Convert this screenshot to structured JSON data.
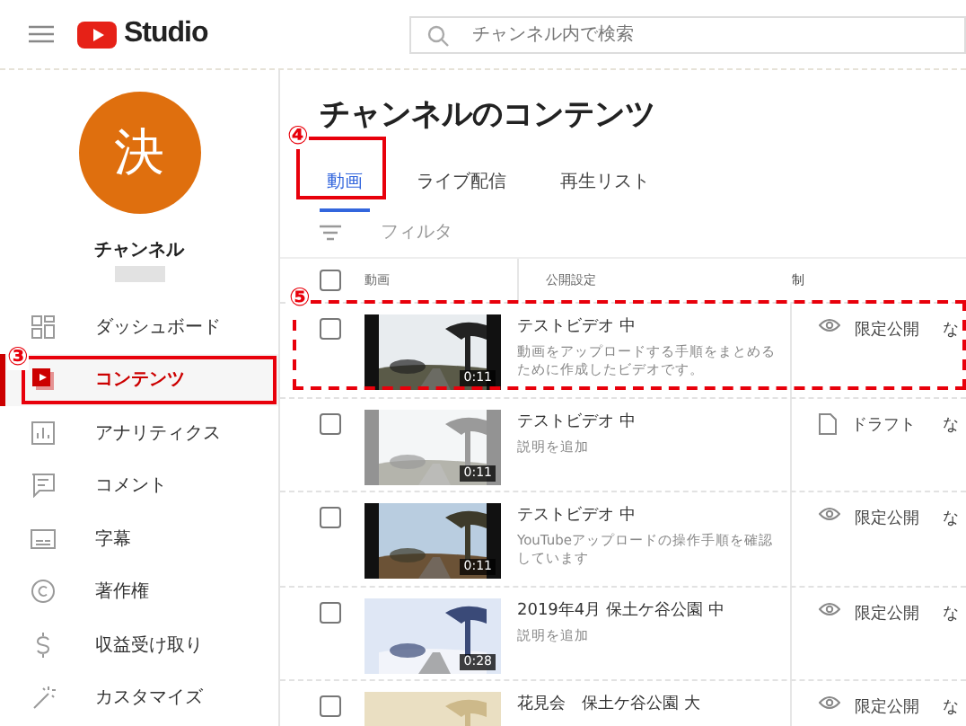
{
  "header": {
    "logo_text": "Studio",
    "search": {
      "placeholder": "チャンネル内で検索"
    }
  },
  "channel": {
    "avatar_letter": "決",
    "name": "チャンネル"
  },
  "sidebar": {
    "items": [
      {
        "label": "ダッシュボード",
        "selected": false
      },
      {
        "label": "コンテンツ",
        "selected": true,
        "annotation": "③"
      },
      {
        "label": "アナリティクス",
        "selected": false
      },
      {
        "label": "コメント",
        "selected": false
      },
      {
        "label": "字幕",
        "selected": false
      },
      {
        "label": "著作権",
        "selected": false
      },
      {
        "label": "収益受け取り",
        "selected": false
      },
      {
        "label": "カスタマイズ",
        "selected": false
      }
    ]
  },
  "page_title": "チャンネルのコンテンツ",
  "tabs": [
    {
      "label": "動画",
      "selected": true,
      "annotation": "④"
    },
    {
      "label": "ライブ配信",
      "selected": false
    },
    {
      "label": "再生リスト",
      "selected": false
    }
  ],
  "filter": {
    "placeholder": "フィルタ"
  },
  "table": {
    "select_all_checked": false,
    "columns": [
      "動画",
      "公開設定",
      "制"
    ],
    "rows": [
      {
        "title": "テストビデオ 中",
        "description": "動画をアップロードする手順をまとめるために作成したビデオです。",
        "duration": "0:11",
        "visibility": "限定公開",
        "column_3": "な",
        "checked": false,
        "draft": false,
        "annotation": "⑤"
      },
      {
        "title": "テストビデオ 中",
        "description": "説明を追加",
        "duration": "0:11",
        "visibility": "ドラフト",
        "column_3": "な",
        "checked": false,
        "draft": true
      },
      {
        "title": "テストビデオ 中",
        "description": "YouTubeアップロードの操作手順を確認しています",
        "duration": "0:11",
        "visibility": "限定公開",
        "column_3": "な",
        "checked": false,
        "draft": false
      },
      {
        "title": "2019年4月 保土ケ谷公園 中",
        "description": "説明を追加",
        "duration": "0:28",
        "visibility": "限定公開",
        "column_3": "な",
        "checked": false,
        "draft": false
      },
      {
        "title": "花見会　保土ケ谷公園 大",
        "visibility": "限定公開",
        "column_3": "な",
        "checked": false,
        "draft": false
      }
    ]
  }
}
